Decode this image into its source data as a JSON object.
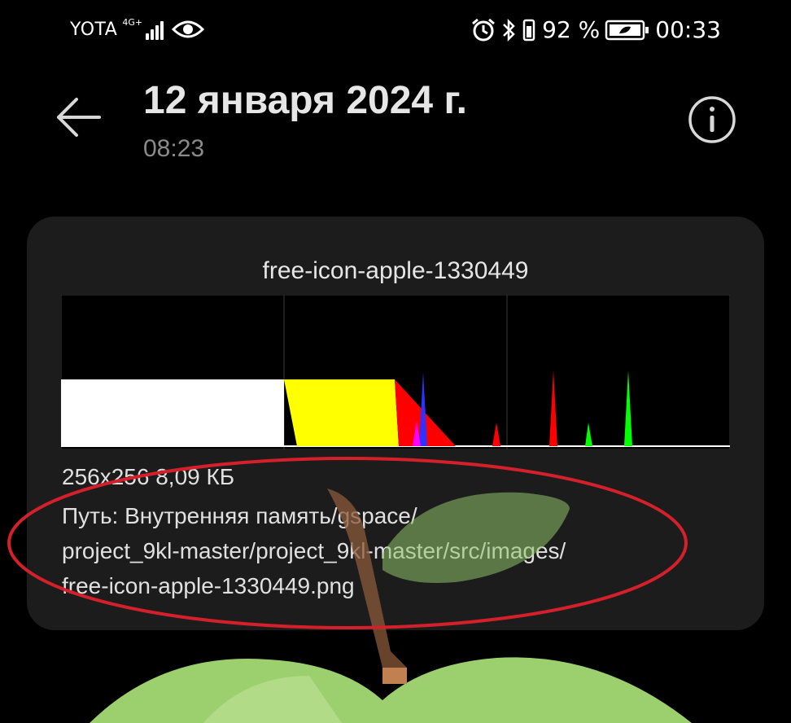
{
  "status_bar": {
    "carrier": "YOTA",
    "network_type": "4G+",
    "battery_percent": "92 %",
    "time": "00:33",
    "icons": [
      "eye-icon",
      "alarm-icon",
      "bluetooth-icon",
      "vibrate-icon",
      "battery-icon"
    ]
  },
  "header": {
    "title": "12 января 2024 г.",
    "subtitle": "08:23",
    "back_icon": "back-arrow-icon",
    "info_icon": "info-icon"
  },
  "details": {
    "histogram_title": "free-icon-apple-1330449",
    "meta": "256x256  8,09 КБ",
    "path_lines": [
      "Путь:  Внутренняя память/gspace/",
      "project_9kl-master/project_9kl-master/src/images/",
      "free-icon-apple-1330449.png"
    ]
  },
  "colors": {
    "background": "#000000",
    "card": "#1c1c1c",
    "annotation": "#d4202a",
    "apple_green": "#9ccf6e"
  }
}
